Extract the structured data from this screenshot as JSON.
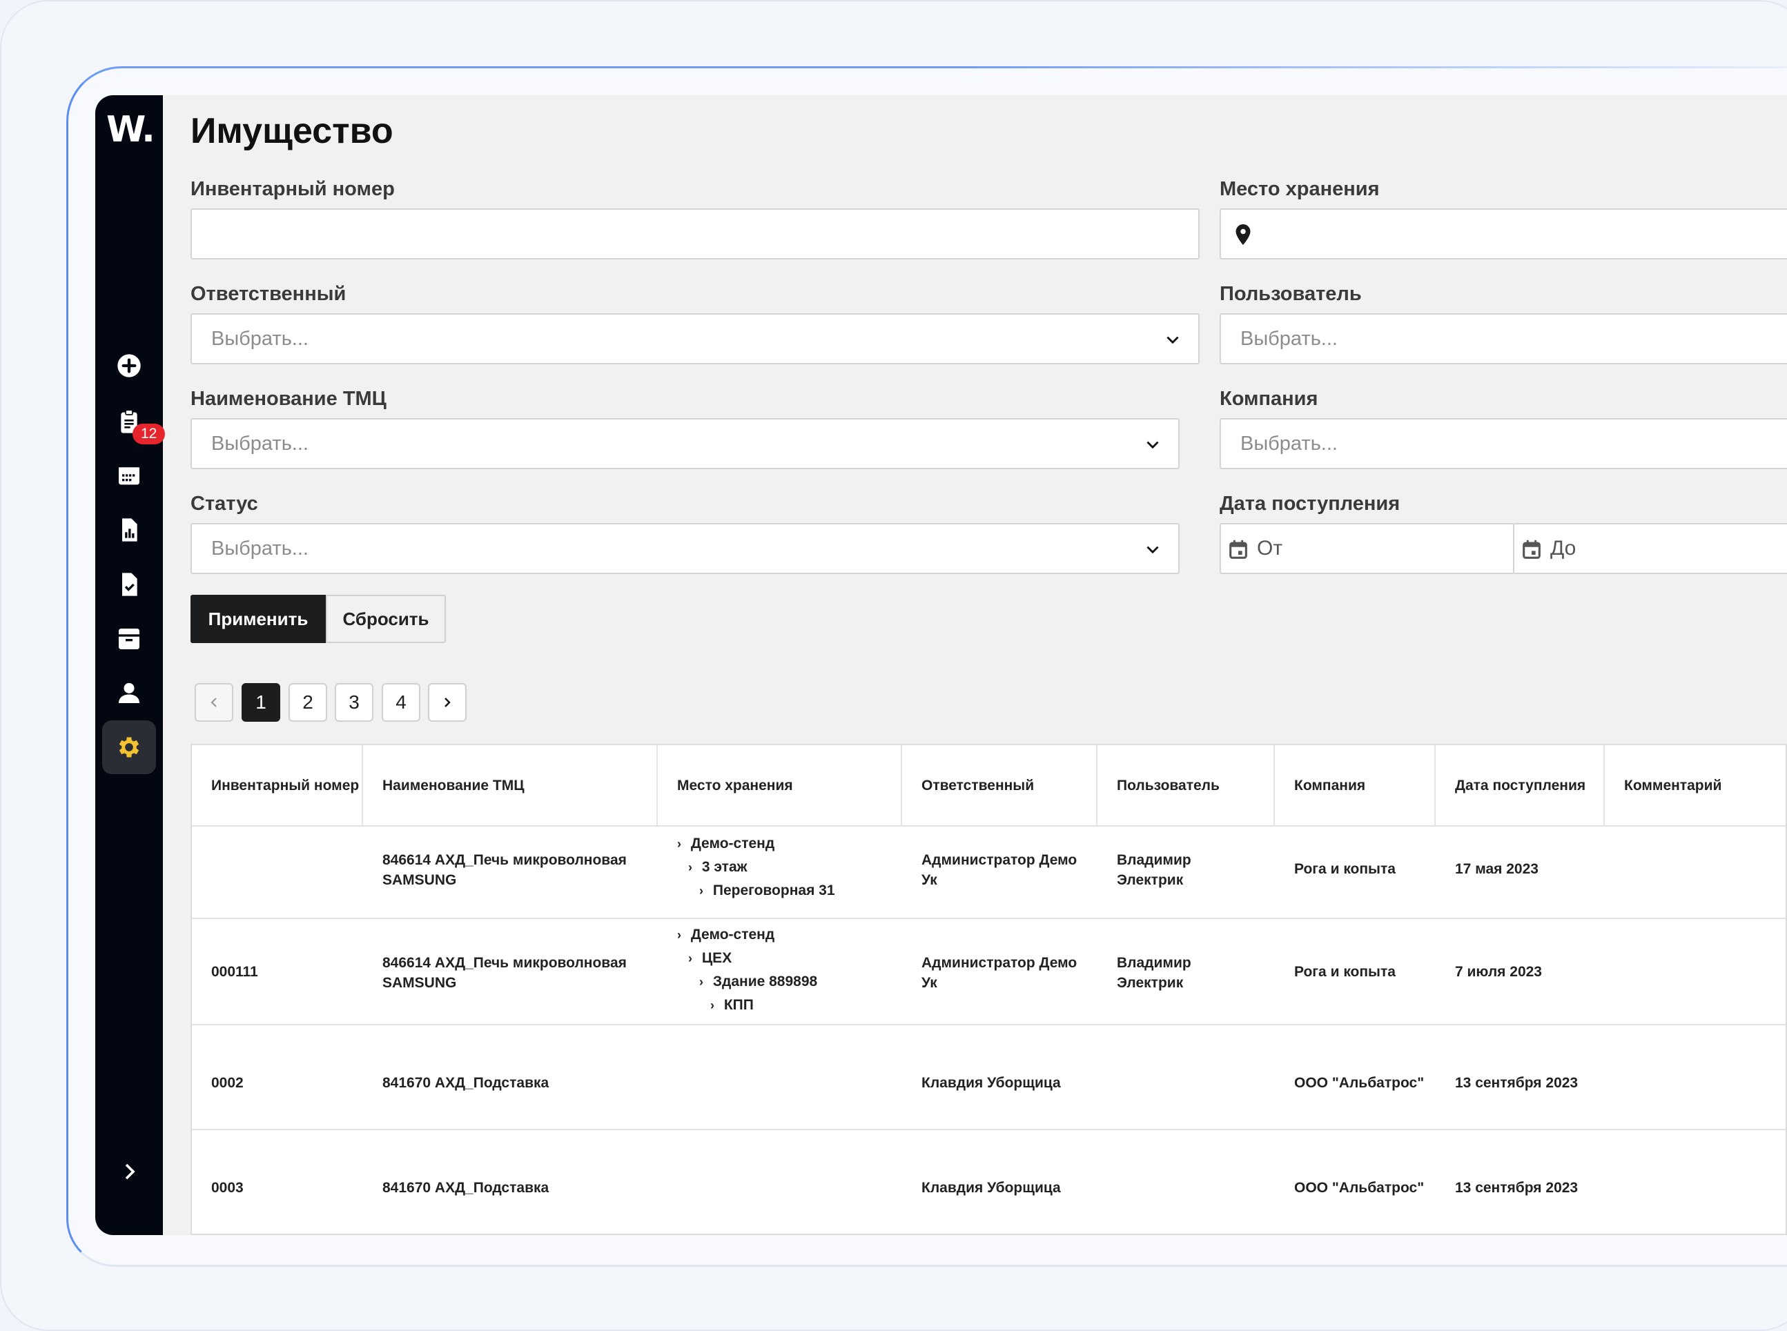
{
  "app": {
    "logo": "W.",
    "notifications_badge": "12"
  },
  "sidebar": {
    "items": [
      {
        "icon": "plus-circle-icon"
      },
      {
        "icon": "clipboard-icon"
      },
      {
        "icon": "calendar-icon"
      },
      {
        "icon": "report-icon"
      },
      {
        "icon": "document-check-icon"
      },
      {
        "icon": "archive-icon"
      },
      {
        "icon": "user-icon"
      },
      {
        "icon": "gear-icon",
        "active": true
      }
    ],
    "expand_icon": "chevron-right-icon",
    "active_color": "#f2c232"
  },
  "page": {
    "title": "Имущество"
  },
  "filters": {
    "inventory_number": {
      "label": "Инвентарный номер",
      "value": ""
    },
    "storage_place": {
      "label": "Место хранения",
      "value": ""
    },
    "responsible": {
      "label": "Ответственный",
      "placeholder": "Выбрать..."
    },
    "user": {
      "label": "Пользователь",
      "placeholder": "Выбрать..."
    },
    "item_name": {
      "label": "Наименование ТМЦ",
      "placeholder": "Выбрать..."
    },
    "company": {
      "label": "Компания",
      "placeholder": "Выбрать..."
    },
    "status": {
      "label": "Статус",
      "placeholder": "Выбрать..."
    },
    "receipt_date": {
      "label": "Дата поступления",
      "from": "От",
      "to": "До"
    }
  },
  "actions": {
    "apply": "Применить",
    "reset": "Сбросить"
  },
  "pagination": {
    "pages": [
      "1",
      "2",
      "3",
      "4"
    ],
    "current": "1"
  },
  "table": {
    "columns": [
      "Инвентарный номер",
      "Наименование ТМЦ",
      "Место хранения",
      "Ответственный",
      "Пользователь",
      "Компания",
      "Дата поступления",
      "Комментарий"
    ],
    "rows": [
      {
        "inv": "",
        "name": "846614 АХД_Печь микроволновая SAMSUNG",
        "place": [
          "Демо-стенд",
          "3 этаж",
          "Переговорная 31"
        ],
        "responsible": "Администратор Демо Ук",
        "user": "Владимир Электрик",
        "company": "Рога и копыта",
        "date": "17 мая 2023",
        "comment": ""
      },
      {
        "inv": "000111",
        "name": "846614 АХД_Печь микроволновая SAMSUNG",
        "place": [
          "Демо-стенд",
          "ЦЕХ",
          "Здание 889898",
          "КПП"
        ],
        "responsible": "Администратор Демо Ук",
        "user": "Владимир Электрик",
        "company": "Рога и копыта",
        "date": "7 июля 2023",
        "comment": ""
      },
      {
        "inv": "0002",
        "name": "841670 АХД_Подставка",
        "place": [],
        "responsible": "Клавдия Уборщица",
        "user": "",
        "company": "ООО \"Альбатрос\"",
        "date": "13 сентября 2023",
        "comment": ""
      },
      {
        "inv": "0003",
        "name": "841670 АХД_Подставка",
        "place": [],
        "responsible": "Клавдия Уборщица",
        "user": "",
        "company": "ООО \"Альбатрос\"",
        "date": "13 сентября 2023",
        "comment": ""
      }
    ]
  }
}
